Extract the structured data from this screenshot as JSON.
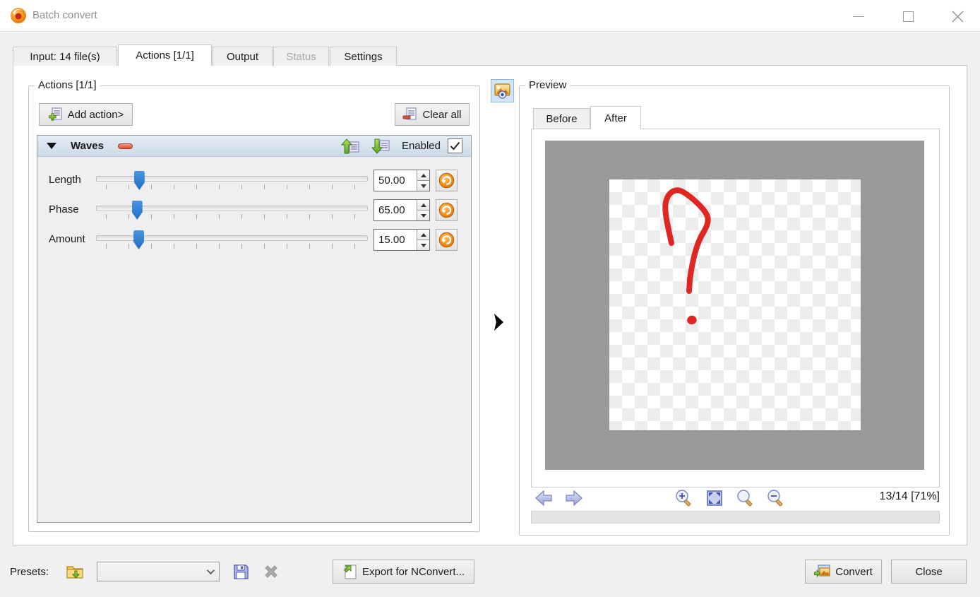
{
  "window": {
    "title": "Batch convert"
  },
  "tabs": [
    {
      "label": "Input: 14 file(s)",
      "state": "normal"
    },
    {
      "label": "Actions [1/1]",
      "state": "active"
    },
    {
      "label": "Output",
      "state": "normal"
    },
    {
      "label": "Status",
      "state": "disabled"
    },
    {
      "label": "Settings",
      "state": "normal"
    }
  ],
  "actions_panel": {
    "group_title": "Actions [1/1]",
    "add_action_label": "Add action>",
    "clear_all_label": "Clear all",
    "action": {
      "name": "Waves",
      "enabled_label": "Enabled",
      "enabled": true,
      "params": [
        {
          "label": "Length",
          "value": "50.00",
          "slider_pos": 0.158
        },
        {
          "label": "Phase",
          "value": "65.00",
          "slider_pos": 0.15
        },
        {
          "label": "Amount",
          "value": "15.00",
          "slider_pos": 0.156
        }
      ]
    }
  },
  "preview_panel": {
    "group_title": "Preview",
    "tabs": [
      {
        "label": "Before",
        "state": "normal"
      },
      {
        "label": "After",
        "state": "active"
      }
    ],
    "status_text": "13/14 [71%]"
  },
  "presets_bar": {
    "label": "Presets:",
    "combo_value": "",
    "export_label": "Export for NConvert..."
  },
  "footer": {
    "convert_label": "Convert",
    "close_label": "Close"
  },
  "icons": {
    "app": "xnview-swirl",
    "add_action": "document-plus",
    "clear_all": "document-minus",
    "move_up": "green-arrow-up-list",
    "move_down": "green-arrow-down-list",
    "reset": "orange-undo-circle",
    "preview_toggle": "picture-eye",
    "nav_back": "arrow-left",
    "nav_forward": "arrow-right",
    "zoom_in": "magnifier-plus",
    "fit": "fit-to-window",
    "zoom_original": "magnifier",
    "zoom_out": "magnifier-minus",
    "presets_folder": "folder-open-down",
    "save_preset": "floppy-disk",
    "delete_preset": "gray-x",
    "export": "page-green-arrow",
    "convert": "image-green-arrow"
  },
  "colors": {
    "header_blue": "#d7e3ee",
    "slider_blue": "#2e7fd6",
    "stroke_red": "#e02622",
    "view_gray": "#999999",
    "reset_orange": "#ef8a0f",
    "dialog_gray": "#f0f0f0"
  }
}
